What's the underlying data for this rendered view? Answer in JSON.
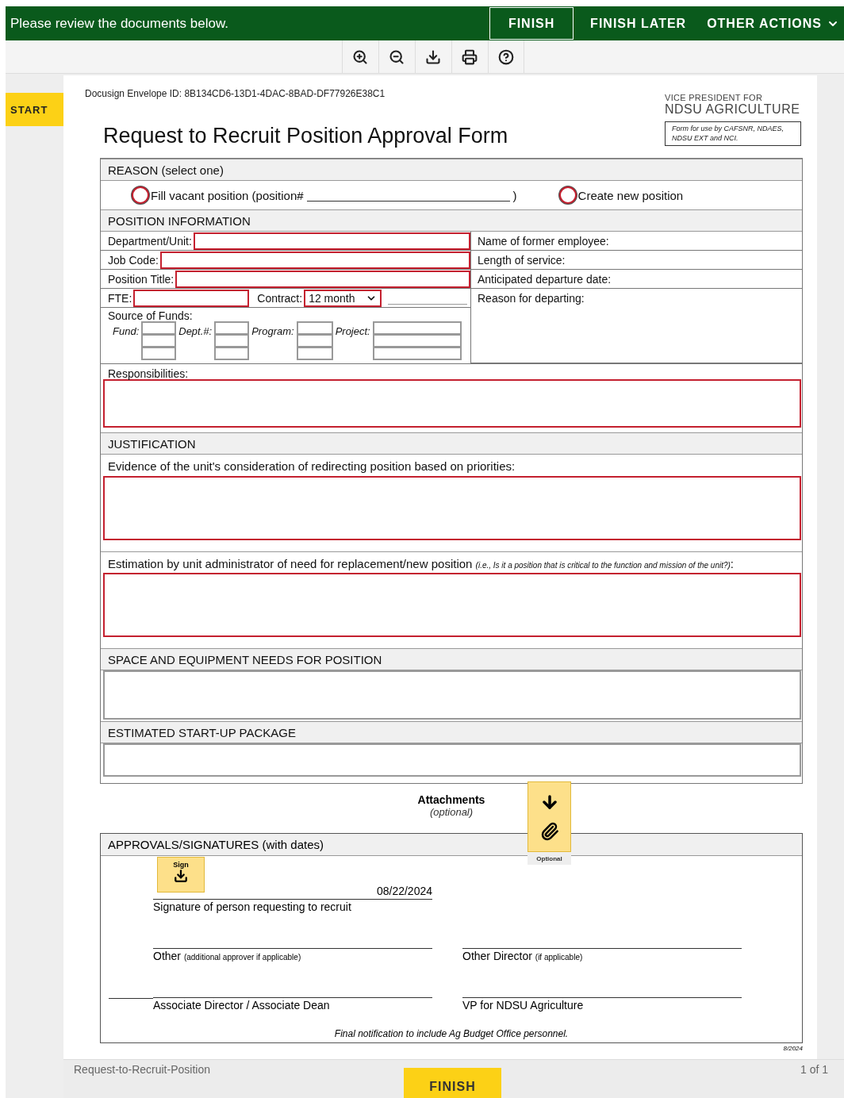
{
  "header": {
    "message": "Please review the documents below.",
    "buttons": [
      {
        "label": "FINISH",
        "kind": "outlined"
      },
      {
        "label": "FINISH LATER",
        "kind": "plain"
      },
      {
        "label": "OTHER ACTIONS",
        "kind": "menu"
      }
    ]
  },
  "toolbar": {
    "tools": [
      {
        "kind": "zoom-in"
      },
      {
        "kind": "zoom-out"
      },
      {
        "kind": "download"
      },
      {
        "kind": "print"
      },
      {
        "kind": "help"
      }
    ]
  },
  "start_tag": "START",
  "document": {
    "envelope_id": "Docusign Envelope ID: 8B134CD6-13D1-4DAC-8BAD-DF77926E38C1",
    "org_small": "VICE PRESIDENT FOR",
    "org_name": "NDSU AGRICULTURE",
    "org_note": "Form for use by CAFSNR, NDAES, NDSU EXT and NCI.",
    "title": "Request to Recruit Position Approval Form",
    "reason": {
      "heading": "REASON (select one)",
      "options": [
        {
          "label": "Fill vacant position (position#",
          "suffix": ")",
          "checked": false
        },
        {
          "label": "Create new position",
          "checked": false
        }
      ]
    },
    "position": {
      "heading": "POSITION INFORMATION",
      "fields": [
        {
          "label": "Department/Unit:"
        },
        {
          "label": "Job Code:"
        },
        {
          "label": "Position Title:"
        }
      ],
      "fte": {
        "label": "FTE:"
      },
      "contract": {
        "label": "Contract:",
        "value": "12 month"
      },
      "funds": {
        "label": "Source of Funds:",
        "columns": [
          {
            "label": "Fund:"
          },
          {
            "label": "Dept.#:"
          },
          {
            "label": "Program:"
          },
          {
            "label": "Project:"
          }
        ]
      },
      "former": [
        "Name of former employee:",
        "Length of service:",
        "Anticipated departure date:",
        "Reason for departing:"
      ],
      "responsibilities": {
        "label": "Responsibilities:",
        "required": true
      }
    },
    "justification": {
      "heading": "JUSTIFICATION",
      "prompts": [
        {
          "label": "Evidence of the unit's consideration of redirecting position based on priorities:",
          "required": true
        },
        {
          "label": "Estimation by unit administrator of need for replacement/new position",
          "note": "(i.e., Is it a position that is critical to the function and mission of the unit?)",
          "end": ":",
          "required": true
        }
      ]
    },
    "sections": [
      {
        "heading": "SPACE AND EQUIPMENT NEEDS FOR POSITION",
        "required": false
      },
      {
        "heading": "ESTIMATED START-UP PACKAGE",
        "required": false
      }
    ],
    "attachments": {
      "title": "Attachments",
      "subtitle": "(optional)",
      "tag": "Optional"
    },
    "approvals": {
      "heading": "APPROVALS/SIGNATURES (with dates)",
      "sign_tag": "Sign",
      "date": "08/22/2024",
      "signatures": [
        {
          "label": "Signature of person requesting to recruit"
        },
        {
          "label": "Other",
          "note": "(additional approver if applicable)"
        },
        {
          "label": "Other Director",
          "note": "(if applicable)"
        },
        {
          "label": "Associate Director / Associate Dean"
        },
        {
          "label": "VP for NDSU Agriculture"
        }
      ],
      "final_note": "Final notification to include Ag Budget Office personnel."
    },
    "version": "8/2024"
  },
  "footer": {
    "doc_name": "Request-to-Recruit-Position",
    "pages": "1 of 1",
    "finish": "FINISH"
  }
}
